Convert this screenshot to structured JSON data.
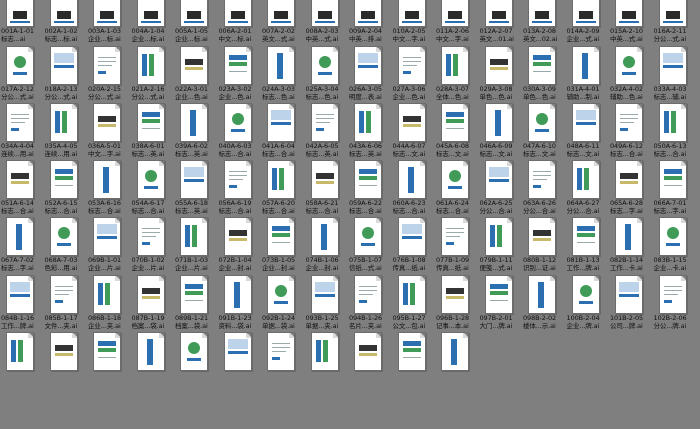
{
  "files": [
    {
      "code": "001A-1-01",
      "name": "标志...ai"
    },
    {
      "code": "002A-1-02",
      "name": "标志...标.ai"
    },
    {
      "code": "003A-1-03",
      "name": "企业...标.ai"
    },
    {
      "code": "004A-1-04",
      "name": "企业...标.ai"
    },
    {
      "code": "005A-1-05",
      "name": "企业...标.ai"
    },
    {
      "code": "006A-2-01",
      "name": "中文...标.ai"
    },
    {
      "code": "007A-2-02",
      "name": "英文...式.ai"
    },
    {
      "code": "008A-2-03",
      "name": "中英...式.ai"
    },
    {
      "code": "009A-2-04",
      "name": "中英...排.ai"
    },
    {
      "code": "010A-2-05",
      "name": "中文...字.ai"
    },
    {
      "code": "011A-2-06",
      "name": "中文...字.ai"
    },
    {
      "code": "012A-2-07",
      "name": "英文...01.ai"
    },
    {
      "code": "013A-2-08",
      "name": "英文...02.ai"
    },
    {
      "code": "014A-2-09",
      "name": "企业...式.ai"
    },
    {
      "code": "015A-2-10",
      "name": "中英...式.ai"
    },
    {
      "code": "016A-2-11",
      "name": "分公...式.ai"
    },
    {
      "code": "017A-2-12",
      "name": "分公...式.ai"
    },
    {
      "code": "018A-2-13",
      "name": "分公...式.ai"
    },
    {
      "code": "020A-2-15",
      "name": "分公...式.ai"
    },
    {
      "code": "021A-2-16",
      "name": "分公...式.ai"
    },
    {
      "code": "022A-3-01",
      "name": "企业...色.ai"
    },
    {
      "code": "023A-3-02",
      "name": "企业...色.ai"
    },
    {
      "code": "024A-3-03",
      "name": "标志...色.ai"
    },
    {
      "code": "025A-3-04",
      "name": "标志...色.ai"
    },
    {
      "code": "026A-3-05",
      "name": "明度...表.ai"
    },
    {
      "code": "027A-3-06",
      "name": "企业...色.ai"
    },
    {
      "code": "028A-3-07",
      "name": "全体...色.ai"
    },
    {
      "code": "029A-3-08",
      "name": "单色...色.ai"
    },
    {
      "code": "030A-3-09",
      "name": "单色...色.ai"
    },
    {
      "code": "031A-4-01",
      "name": "辅助...制.ai"
    },
    {
      "code": "032A-4-02",
      "name": "辅助...色.ai"
    },
    {
      "code": "033A-4-03",
      "name": "标志...辅.ai"
    },
    {
      "code": "034A-4-04",
      "name": "连续...用.ai"
    },
    {
      "code": "035A-4-05",
      "name": "连续...用.ai"
    },
    {
      "code": "036A-5-01",
      "name": "中文...字.ai"
    },
    {
      "code": "038A-6-01",
      "name": "标志...英.ai"
    },
    {
      "code": "039A-6-02",
      "name": "标志...英.ai"
    },
    {
      "code": "040A-6-03",
      "name": "标志...合.ai"
    },
    {
      "code": "041A-6-04",
      "name": "标志...合.ai"
    },
    {
      "code": "042A-6-05",
      "name": "标志...英.ai"
    },
    {
      "code": "043A-6-06",
      "name": "标志...英.ai"
    },
    {
      "code": "044A-6-07",
      "name": "标志...文.ai"
    },
    {
      "code": "045A-6-08",
      "name": "标志...文.ai"
    },
    {
      "code": "046A-6-09",
      "name": "标志...文.ai"
    },
    {
      "code": "047A-6-10",
      "name": "标志...文.ai"
    },
    {
      "code": "048A-6-11",
      "name": "标志...文.ai"
    },
    {
      "code": "049A-6-12",
      "name": "标志...合.ai"
    },
    {
      "code": "050A-6-13",
      "name": "标志...合.ai"
    },
    {
      "code": "051A-6-14",
      "name": "标志...合.ai"
    },
    {
      "code": "052A-6-15",
      "name": "标志...合.ai"
    },
    {
      "code": "053A-6-16",
      "name": "标志...合.ai"
    },
    {
      "code": "054A-6-17",
      "name": "标志...合.ai"
    },
    {
      "code": "055A-6-18",
      "name": "标志...英.ai"
    },
    {
      "code": "056A-6-19",
      "name": "标志...合.ai"
    },
    {
      "code": "057A-6-20",
      "name": "标志...合.ai"
    },
    {
      "code": "058A-6-21",
      "name": "标志...合.ai"
    },
    {
      "code": "059A-6-22",
      "name": "标志...合.ai"
    },
    {
      "code": "060A-6-23",
      "name": "标志...合.ai"
    },
    {
      "code": "061A-6-24",
      "name": "标志...合.ai"
    },
    {
      "code": "062A-6-25",
      "name": "分公...合.ai"
    },
    {
      "code": "063A-6-26",
      "name": "分公...合.ai"
    },
    {
      "code": "064A-6-27",
      "name": "分公...合.ai"
    },
    {
      "code": "065A-6-28",
      "name": "标志...字.ai"
    },
    {
      "code": "066A-7-01",
      "name": "标志...字.ai"
    },
    {
      "code": "067A-7-02",
      "name": "标志...字.ai"
    },
    {
      "code": "068A-7-03",
      "name": "色彩...用.ai"
    },
    {
      "code": "069B-1-01",
      "name": "企业...片.ai"
    },
    {
      "code": "070B-1-02",
      "name": "企业...片.ai"
    },
    {
      "code": "071B-1-03",
      "name": "企业...片.ai"
    },
    {
      "code": "072B-1-04",
      "name": "企业...封.ai"
    },
    {
      "code": "073B-1-05",
      "name": "企业...封.ai"
    },
    {
      "code": "074B-1-06",
      "name": "企业...封.ai"
    },
    {
      "code": "075B-1-07",
      "name": "信纸...式.ai"
    },
    {
      "code": "076B-1-08",
      "name": "传真...纸.ai"
    },
    {
      "code": "077B-1-09",
      "name": "传真...纸.ai"
    },
    {
      "code": "079B-1-11",
      "name": "便笺...式.ai"
    },
    {
      "code": "080B-1-12",
      "name": "识别...证.ai"
    },
    {
      "code": "081B-1-13",
      "name": "工作...牌.ai"
    },
    {
      "code": "082B-1-14",
      "name": "工作...卡.ai"
    },
    {
      "code": "083B-1-15",
      "name": "企业...卡.ai"
    },
    {
      "code": "084B-1-16",
      "name": "工作...牌.ai"
    },
    {
      "code": "085B-1-17",
      "name": "文件...夹.ai"
    },
    {
      "code": "086B-1-18",
      "name": "企业...夹.ai"
    },
    {
      "code": "087B-1-19",
      "name": "档案...袋.ai"
    },
    {
      "code": "089B-1-21",
      "name": "档案...袋.ai"
    },
    {
      "code": "091B-1-23",
      "name": "资料...袋.ai"
    },
    {
      "code": "092B-1-24",
      "name": "单据...袋.ai"
    },
    {
      "code": "093B-1-25",
      "name": "单据...夹.ai"
    },
    {
      "code": "094B-1-26",
      "name": "名片...夹.ai"
    },
    {
      "code": "095B-1-27",
      "name": "公文...包.ai"
    },
    {
      "code": "096B-1-28",
      "name": "记事...本.ai"
    },
    {
      "code": "097B-2-01",
      "name": "大门...牌.ai"
    },
    {
      "code": "098B-2-02",
      "name": "楼体...示.ai"
    },
    {
      "code": "100B-2-04",
      "name": "企业...牌.ai"
    },
    {
      "code": "101B-2-05",
      "name": "公司...牌.ai"
    },
    {
      "code": "102B-2-06",
      "name": "分公...牌.ai"
    },
    {
      "code": "",
      "name": ""
    },
    {
      "code": "",
      "name": ""
    },
    {
      "code": "",
      "name": ""
    },
    {
      "code": "",
      "name": ""
    },
    {
      "code": "",
      "name": ""
    },
    {
      "code": "",
      "name": ""
    },
    {
      "code": "",
      "name": ""
    },
    {
      "code": "",
      "name": ""
    },
    {
      "code": "",
      "name": ""
    },
    {
      "code": "",
      "name": ""
    },
    {
      "code": "",
      "name": ""
    }
  ],
  "colors": {
    "background": "#7f7f7f",
    "accent_blue": "#2c6fb0",
    "accent_green": "#3f9b57"
  }
}
